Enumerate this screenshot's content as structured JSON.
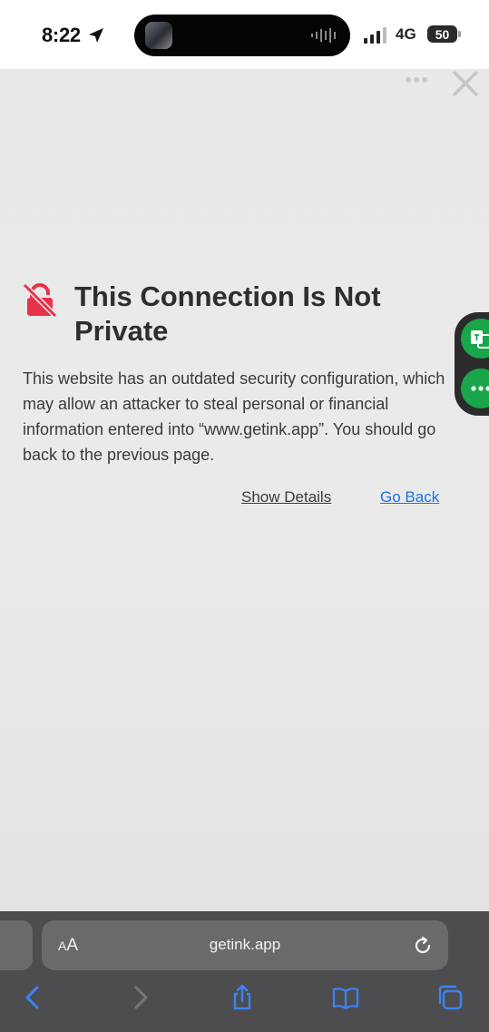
{
  "status": {
    "time": "8:22",
    "network": "4G",
    "battery": "50"
  },
  "icons": {
    "location": "location-arrow-icon",
    "signal": "signal-bars-icon",
    "more": "more-dots-icon",
    "close": "close-icon",
    "lock": "broken-lock-icon",
    "reload": "reload-icon",
    "back": "chevron-left-icon",
    "forward": "chevron-right-icon",
    "share": "share-icon",
    "bookmarks": "book-icon",
    "tabs": "tabs-icon"
  },
  "warning": {
    "title": "This Connection Is Not Private",
    "message": "This website has an outdated security configuration, which may allow an attacker to steal personal or financial information entered into “www.getink.app”. You should go back to the previous page.",
    "show_details": "Show Details",
    "go_back": "Go Back"
  },
  "address_bar": {
    "aa_small": "A",
    "aa_large": "A",
    "url": "getink.app"
  },
  "colors": {
    "lock": "#e8324a",
    "link": "#1a73e8",
    "widget_green": "#19a64a"
  }
}
